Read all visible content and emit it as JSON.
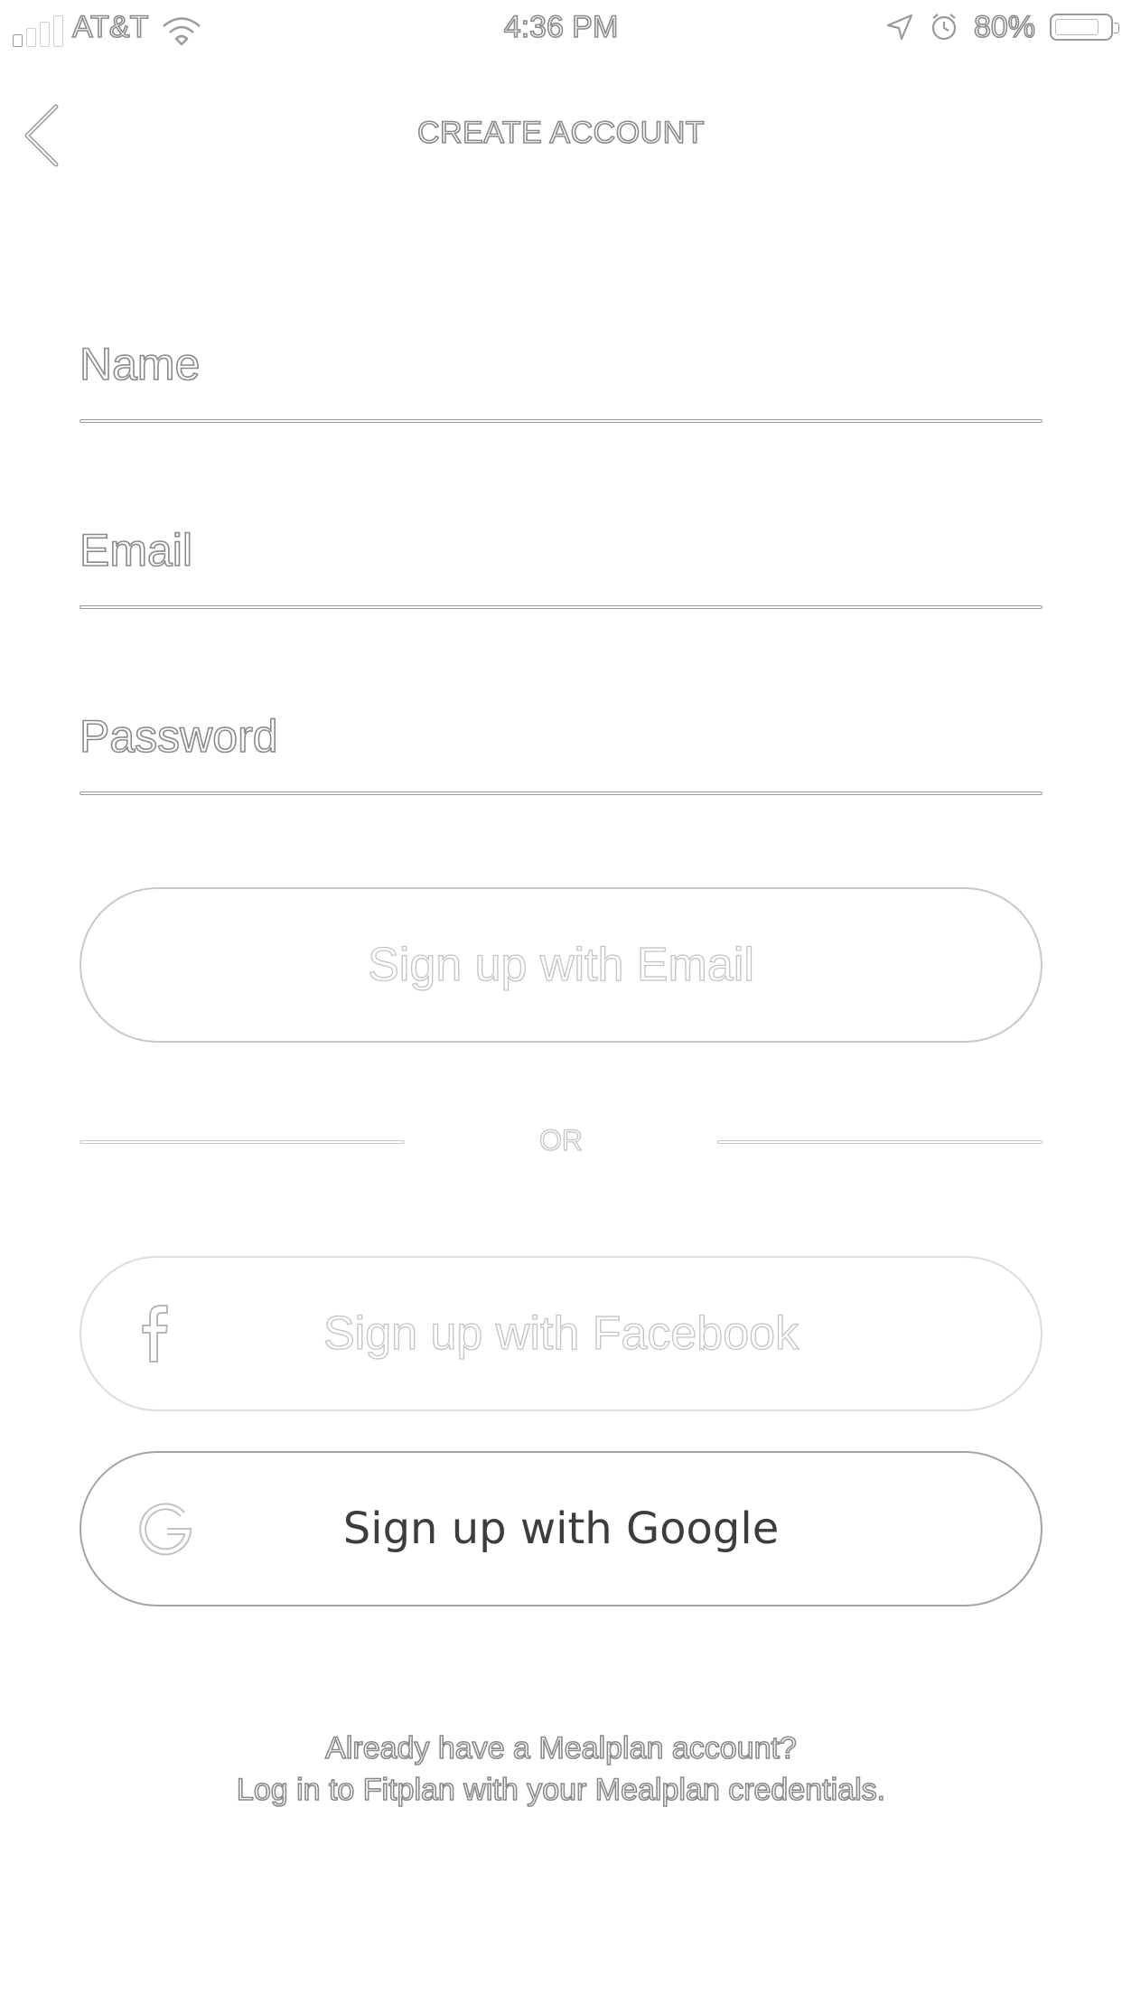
{
  "status_bar": {
    "carrier": "AT&T",
    "time": "4:36 PM",
    "battery": "80%",
    "battery_level": 0.8,
    "signal_bars_active": 1,
    "signal_bars_total": 4,
    "icons": [
      "signal-icon",
      "wifi-icon",
      "location-arrow-icon",
      "alarm-clock-icon",
      "battery-icon"
    ]
  },
  "nav": {
    "title": "CREATE ACCOUNT",
    "back_icon": "chevron-left-icon"
  },
  "form": {
    "name_placeholder": "Name",
    "email_placeholder": "Email",
    "password_placeholder": "Password"
  },
  "buttons": {
    "email_label": "Sign up with Email",
    "or_label": "OR",
    "facebook_label": "Sign up with Facebook",
    "facebook_icon": "facebook-icon",
    "google_label": "Sign up with Google",
    "google_icon": "google-icon"
  },
  "footer": {
    "line1": "Already have a Mealplan account?",
    "line2": "Log in to Fitplan with your Mealplan credentials."
  },
  "colors": {
    "background": "#ffffff",
    "outline_text": "#8a8a8a",
    "google_text": "#3d3d3d",
    "border_light": "#c9c9c9"
  }
}
